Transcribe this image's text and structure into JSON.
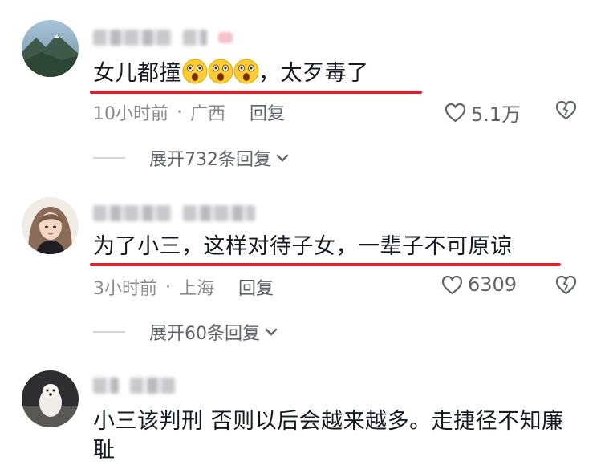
{
  "comments": [
    {
      "text_main": "女儿都撞",
      "text_after": "，太歹毒了",
      "emoji": [
        "astonished-face",
        "astonished-face",
        "astonished-face"
      ],
      "time": "10小时前",
      "sep": "·",
      "location": "广西",
      "reply_label": "回复",
      "likes": "5.1万",
      "expand_label": "展开732条回复"
    },
    {
      "text": "为了小三，这样对待子女，一辈子不可原谅",
      "time": "3小时前",
      "sep": "·",
      "location": "上海",
      "reply_label": "回复",
      "likes": "6309",
      "expand_label": "展开60条回复"
    },
    {
      "text": "小三该判刑 否则以后会越来越多。走捷径不知廉耻"
    }
  ],
  "colors": {
    "underline": "#e01e2b",
    "meta": "#8a8b91",
    "text": "#161823"
  },
  "icons": [
    "heart-outline-icon",
    "broken-heart-icon",
    "chevron-down-icon"
  ]
}
